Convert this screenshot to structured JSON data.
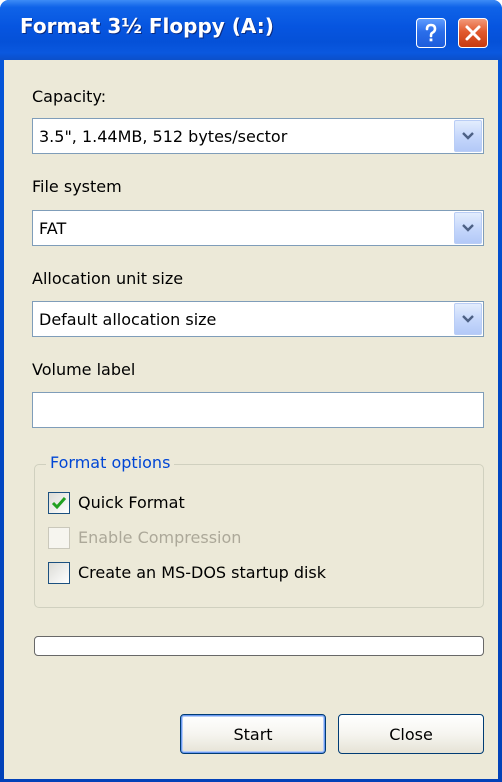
{
  "window": {
    "title": "Format 3½ Floppy (A:)",
    "help_icon": "question-mark-icon",
    "close_icon": "close-x-icon"
  },
  "capacity": {
    "label": "Capacity:",
    "value": "3.5\",  1.44MB, 512 bytes/sector"
  },
  "file_system": {
    "label": "File system",
    "value": "FAT"
  },
  "allocation": {
    "label": "Allocation unit size",
    "value": "Default allocation size"
  },
  "volume": {
    "label": "Volume label",
    "value": "",
    "placeholder": ""
  },
  "format_options": {
    "legend": "Format options",
    "quick_format": {
      "label": "Quick Format",
      "checked": true,
      "enabled": true
    },
    "compression": {
      "label": "Enable Compression",
      "checked": false,
      "enabled": false
    },
    "startup_disk": {
      "label": "Create an MS-DOS startup disk",
      "checked": false,
      "enabled": true
    }
  },
  "progress": {
    "percent": 0
  },
  "buttons": {
    "start": "Start",
    "close": "Close"
  },
  "colors": {
    "titlebar": "#0655e0",
    "dialog_bg": "#ece9d8",
    "group_legend": "#0046d5",
    "close_button": "#e25a2e",
    "check_mark": "#21a121"
  }
}
